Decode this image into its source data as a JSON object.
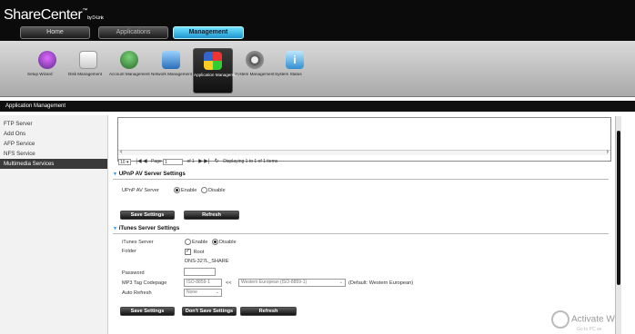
{
  "app": {
    "logo_main": "ShareCenter",
    "logo_sup": "™",
    "logo_sub": "by D-Link"
  },
  "nav": {
    "home": "Home",
    "applications": "Applications",
    "management": "Management"
  },
  "iconbar": [
    {
      "label": "Setup Wizard",
      "icon": "wizard-hat-icon",
      "color": "#7a4aa8"
    },
    {
      "label": "Disk Management",
      "icon": "disk-icon",
      "color": "#c33"
    },
    {
      "label": "Account Management",
      "icon": "users-icon",
      "color": "#3b8a3b"
    },
    {
      "label": "Network Management",
      "icon": "network-icon",
      "color": "#3070b8"
    },
    {
      "label": "Application Management",
      "icon": "applications-icon",
      "color": "#c8a020"
    },
    {
      "label": "System Management",
      "icon": "gear-icon",
      "color": "#7a7a7a"
    },
    {
      "label": "System Status",
      "icon": "info-icon",
      "color": "#3da1d8"
    }
  ],
  "section_bar": "Application Management",
  "sidebar": {
    "items": [
      "FTP Server",
      "Add Ons",
      "AFP Service",
      "NFS Service",
      "Multimedia Services"
    ],
    "active_index": 4
  },
  "pager": {
    "page_size": "10",
    "page_label": "Page",
    "page_value": "1",
    "of_label": "of 1",
    "display_text": "Displaying 1 to 1 of 1 items"
  },
  "upnp": {
    "title": "UPnP AV Server Settings",
    "server_label": "UPnP AV Server",
    "enable": "Enable",
    "disable": "Disable",
    "state": "enable",
    "save": "Save Settings",
    "refresh": "Refresh"
  },
  "itunes": {
    "title": "iTunes Server Settings",
    "server_label": "iTunes Server",
    "enable": "Enable",
    "disable": "Disable",
    "state": "disable",
    "folder_label": "Folder",
    "folder_check": "Root",
    "folder_path": "DNS-327L_SHARE",
    "password_label": "Password",
    "password_value": "",
    "mp3_label": "MP3 Tag Codepage",
    "mp3_value": "ISO-8859-1",
    "mp3_arrow": "<<",
    "mp3_select": "Western European (ISO-8859-1)",
    "mp3_default": "(Default: Western European)",
    "auto_refresh_label": "Auto Refresh",
    "auto_refresh_value": "None",
    "save": "Save Settings",
    "dont_save": "Don't Save Settings",
    "refresh": "Refresh"
  },
  "watermark": {
    "line1": "Activate W",
    "line2": "Go to PC se"
  }
}
